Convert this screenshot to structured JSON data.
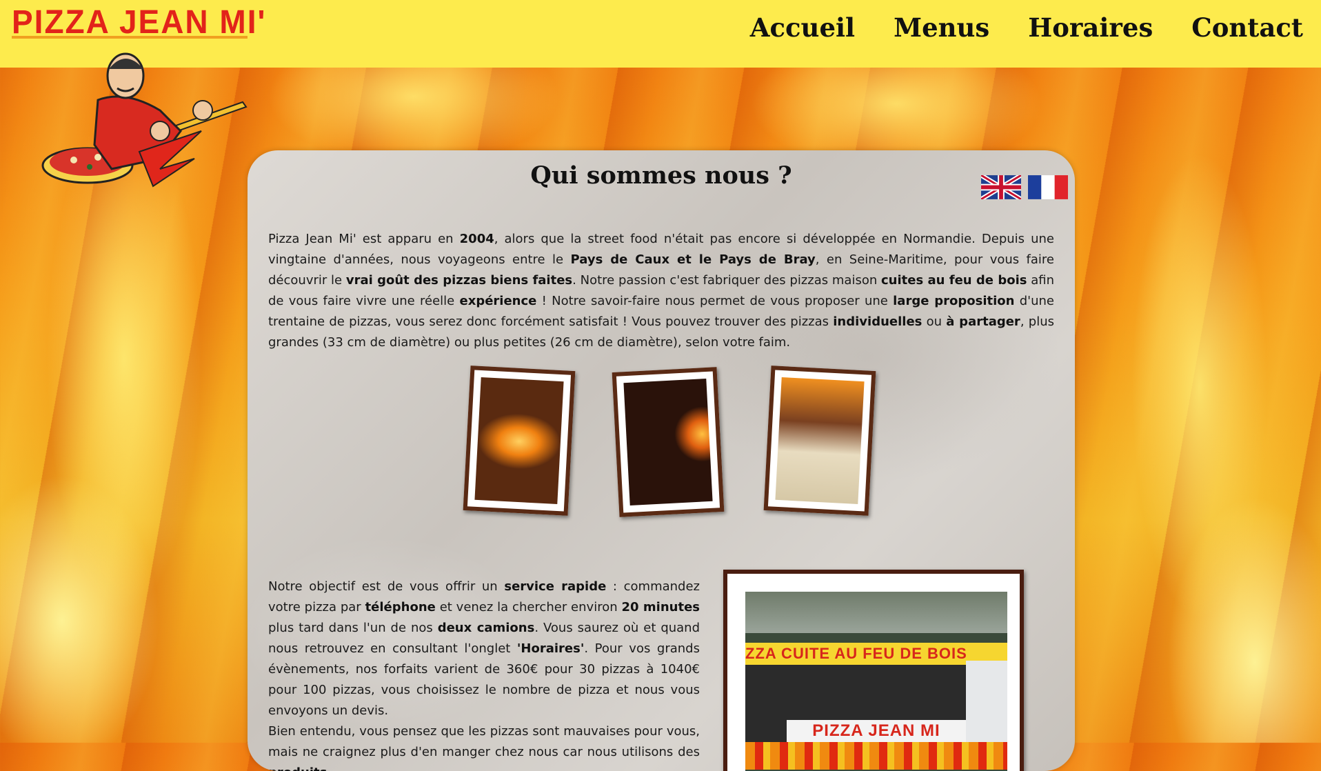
{
  "header": {
    "logo_text": "PIZZA JEAN MI'",
    "nav": [
      "Accueil",
      "Menus",
      "Horaires",
      "Contact"
    ]
  },
  "panel": {
    "title": "Qui sommes nous ?",
    "intro": [
      {
        "t": "Pizza Jean Mi' est apparu en ",
        "b": false
      },
      {
        "t": "2004",
        "b": true
      },
      {
        "t": ", alors que la street food n'était pas encore si développée en Normandie. Depuis une vingtaine d'années, nous voyageons entre le ",
        "b": false
      },
      {
        "t": "Pays de Caux et le Pays de Bray",
        "b": true
      },
      {
        "t": ", en Seine-Maritime, pour vous faire découvrir le ",
        "b": false
      },
      {
        "t": "vrai goût des pizzas biens faites",
        "b": true
      },
      {
        "t": ". Notre passion c'est fabriquer des pizzas maison ",
        "b": false
      },
      {
        "t": "cuites au feu de bois",
        "b": true
      },
      {
        "t": " afin de vous faire vivre une réelle ",
        "b": false
      },
      {
        "t": "expérience",
        "b": true
      },
      {
        "t": " ! Notre savoir-faire nous permet de vous proposer une ",
        "b": false
      },
      {
        "t": "large proposition",
        "b": true
      },
      {
        "t": " d'une trentaine de pizzas, vous serez donc forcément satisfait ! Vous pouvez trouver des pizzas ",
        "b": false
      },
      {
        "t": "individuelles",
        "b": true
      },
      {
        "t": " ou ",
        "b": false
      },
      {
        "t": "à partager",
        "b": true
      },
      {
        "t": ", plus grandes (33 cm de diamètre) ou plus petites (26 cm de diamètre), selon votre faim.",
        "b": false
      }
    ],
    "service": [
      {
        "t": "Notre objectif est de vous offrir un ",
        "b": false
      },
      {
        "t": "service rapide",
        "b": true
      },
      {
        "t": " : commandez votre pizza par ",
        "b": false
      },
      {
        "t": "téléphone",
        "b": true
      },
      {
        "t": " et venez la chercher environ ",
        "b": false
      },
      {
        "t": "20 minutes",
        "b": true
      },
      {
        "t": " plus tard dans l'un de nos ",
        "b": false
      },
      {
        "t": "deux camions",
        "b": true
      },
      {
        "t": ". Vous saurez où et quand nous retrouvez en consultant l'onglet ",
        "b": false
      },
      {
        "t": "'Horaires'",
        "b": true
      },
      {
        "t": ". Pour vos grands évènements, nos forfaits varient de 360€ pour 30 pizzas à 1040€ pour 100 pizzas, vous choisissez le nombre de pizza et nous vous envoyons un devis.",
        "b": false
      }
    ],
    "quality": [
      {
        "t": "Bien entendu, vous pensez que les pizzas sont mauvaises pour vous, mais ne craignez plus d'en manger chez nous car nous utilisons des ",
        "b": false
      },
      {
        "t": "produits",
        "b": true
      }
    ],
    "truck_banner": "ZZA CUITE AU FEU DE BOIS",
    "truck_name": "PIZZA JEAN MI"
  },
  "colors": {
    "header_bg": "#fdeb4d",
    "logo_red": "#e2231a",
    "frame_brown": "#5a2a14"
  }
}
